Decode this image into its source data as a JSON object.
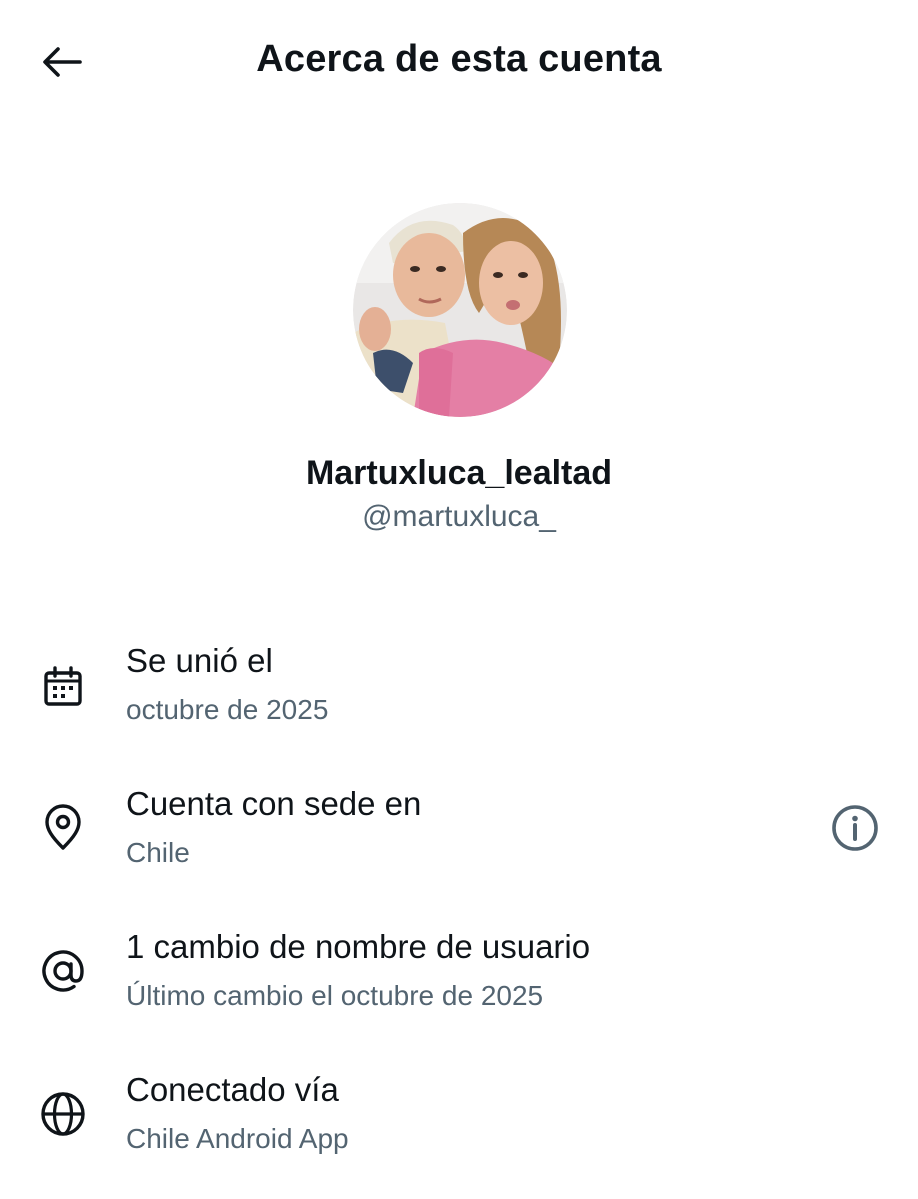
{
  "header": {
    "back_icon": "arrow-left-icon",
    "title": "Acerca de esta cuenta"
  },
  "profile": {
    "avatar_icon": "profile-photo",
    "display_name": "Martuxluca_lealtad",
    "handle": "@martuxluca_"
  },
  "rows": [
    {
      "icon": "calendar-icon",
      "title": "Se unió el",
      "subtitle": "octubre de 2025"
    },
    {
      "icon": "location-pin-icon",
      "title": "Cuenta con sede en",
      "subtitle": "Chile",
      "action_icon": "info-icon"
    },
    {
      "icon": "at-sign-icon",
      "title": "1 cambio de nombre de usuario",
      "subtitle": "Último cambio el octubre de 2025"
    },
    {
      "icon": "globe-icon",
      "title": "Conectado vía",
      "subtitle": "Chile Android App"
    }
  ],
  "colors": {
    "text_primary": "#0f1419",
    "text_secondary": "#536471",
    "background": "#ffffff"
  }
}
